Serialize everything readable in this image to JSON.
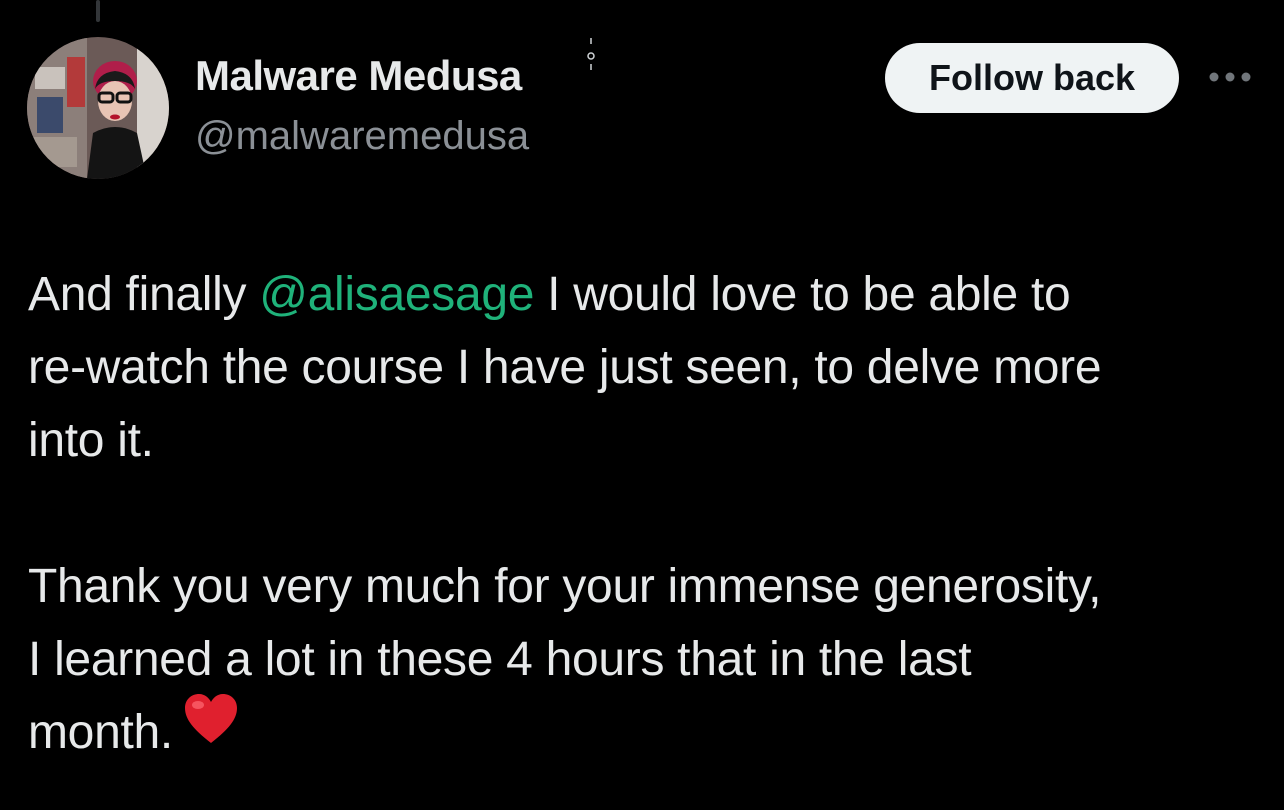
{
  "tweet": {
    "author": {
      "display_name": "Malware Medusa",
      "handle": "@malwaremedusa"
    },
    "follow_button_label": "Follow back",
    "more_icon": "more-horizontal-icon",
    "text": {
      "line_1_before": "And finally ",
      "mention": "@alisaesage",
      "line_1_after": " I would love to be able to",
      "line_2": "re-watch the course I have just seen, to delve more",
      "line_3": "into it.",
      "line_4": "Thank you very much for your immense generosity,",
      "line_5": "I learned a lot in these 4 hours that in the last",
      "line_6": "month.",
      "emoji": "heart-emoji"
    }
  },
  "colors": {
    "background": "#000000",
    "primary_text": "#e7e9ea",
    "secondary_text": "#8b9096",
    "mention": "#1fb27a",
    "button_bg": "#eff3f4",
    "button_text": "#0f1419",
    "heart": "#e0202e"
  }
}
